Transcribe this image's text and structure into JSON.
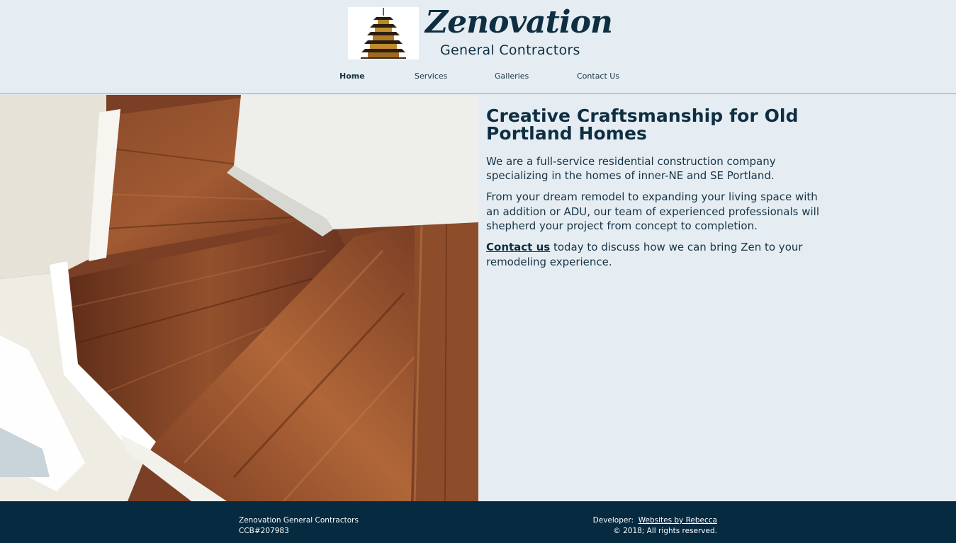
{
  "brand": {
    "name": "Zenovation",
    "tagline": "General Contractors"
  },
  "nav": {
    "items": [
      {
        "label": "Home",
        "active": true
      },
      {
        "label": "Services",
        "active": false
      },
      {
        "label": "Galleries",
        "active": false
      },
      {
        "label": "Contact Us",
        "active": false
      }
    ]
  },
  "main": {
    "heading": "Creative Craftsmanship for Old Portland Homes",
    "paragraph_1": "We are a full-service residential construction company specializing in the homes of inner-NE and SE Portland.",
    "paragraph_2": "From your dream remodel to expanding your living space with an addition or ADU, our team of experienced professionals will shepherd your project from concept to completion.",
    "contact_link": "Contact us",
    "paragraph_3_rest": " today to discuss how we can bring Zen to your remodeling experience."
  },
  "footer": {
    "company": "Zenovation General Contractors",
    "license": "CCB#207983",
    "developer_label": "Developer:",
    "developer_link": "Websites by Rebecca",
    "copyright": "© 2018; All rights reserved."
  },
  "icons": {
    "logo": "pagoda-icon"
  },
  "colors": {
    "background": "#e6edf2",
    "brand_dark": "#0e2e42",
    "footer_bg": "#062a3f",
    "header_border": "#7fb1c9"
  }
}
